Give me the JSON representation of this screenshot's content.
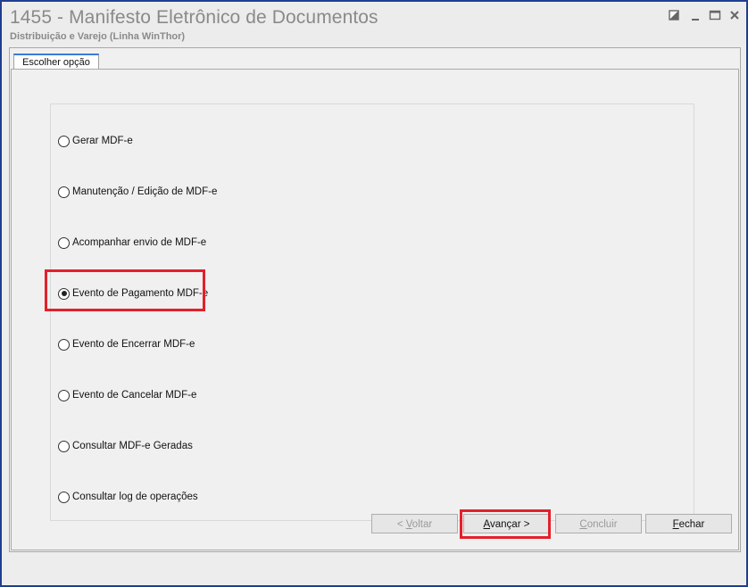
{
  "window": {
    "title": "1455 - Manifesto Eletrônico de Documentos",
    "subtitle": "Distribuição e Varejo (Linha WinThor)"
  },
  "tab": {
    "label": "Escolher opção"
  },
  "options": [
    {
      "label": "Gerar MDF-e",
      "checked": false
    },
    {
      "label": "Manutenção / Edição de MDF-e",
      "checked": false
    },
    {
      "label": "Acompanhar envio de MDF-e",
      "checked": false
    },
    {
      "label": "Evento de Pagamento MDF-e",
      "checked": true
    },
    {
      "label": "Evento de Encerrar MDF-e",
      "checked": false
    },
    {
      "label": "Evento de Cancelar MDF-e",
      "checked": false
    },
    {
      "label": "Consultar MDF-e Geradas",
      "checked": false
    },
    {
      "label": "Consultar log de operações",
      "checked": false
    }
  ],
  "buttons": {
    "back": {
      "prefix": "< ",
      "hotkey": "V",
      "rest": "oltar",
      "enabled": false
    },
    "next": {
      "prefix": "",
      "hotkey": "A",
      "rest": "vançar >",
      "enabled": true
    },
    "finish": {
      "prefix": "",
      "hotkey": "C",
      "rest": "oncluir",
      "enabled": false
    },
    "close": {
      "prefix": "",
      "hotkey": "F",
      "rest": "echar",
      "enabled": true
    }
  },
  "colors": {
    "highlight": "#e3202b",
    "window_border": "#1f3f8f",
    "tab_accent": "#3a7bd5"
  }
}
